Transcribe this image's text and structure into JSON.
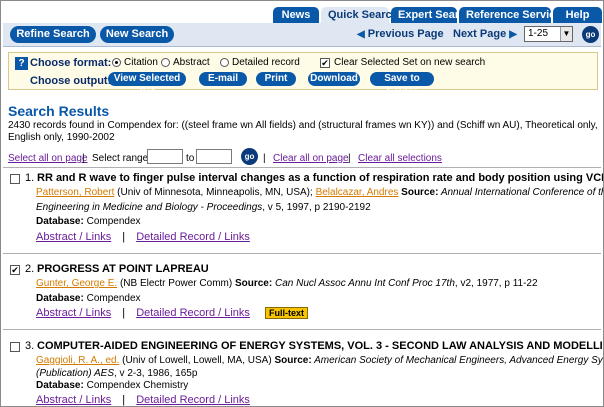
{
  "tabs": [
    "News",
    "Quick Search",
    "Expert Search",
    "Reference Services",
    "Help"
  ],
  "toolbar": {
    "refine_label": "Refine Search",
    "new_search_label": "New Search",
    "prev_label": "Previous Page",
    "next_label": "Next Page",
    "range_value": "1-25",
    "go_label": "go"
  },
  "options": {
    "format_label": "Choose format:",
    "output_label": "Choose output:",
    "formats": [
      "Citation",
      "Abstract",
      "Detailed record"
    ],
    "selected_format": "Citation",
    "clear_label": "Clear Selected Set on new search",
    "clear_checked": true,
    "buttons": [
      "View Selected Set",
      "E-mail",
      "Print",
      "Download",
      "Save to Folder"
    ]
  },
  "results": {
    "title": "Search Results",
    "summary": "2430 records found in Compendex for: ((steel frame wn All fields) and (structural frames wn KY)) and (Schiff wn AU), Theoretical only, English only, 1990-2002",
    "select_all": "Select all on page",
    "select_range": "Select range:",
    "to_label": "to",
    "clear_page": "Clear all on page",
    "clear_selections": "Clear all selections",
    "go_label": "go"
  },
  "records": [
    {
      "num": "1.",
      "checked": false,
      "title": "RR and R wave to finger pulse interval changes as a function of respiration rate and body position using VCRS",
      "authors": [
        "Patterson, Robert",
        "Belalcazar, Andres"
      ],
      "aff1": " (Univ of Minnesota, Minneapolis, MN, USA); ",
      "aff2": " ",
      "source_label": "Source:",
      "source1": " Annual International Conference of the IEEE",
      "source2": "Engineering in Medicine and Biology - Proceedings",
      "source3": ", v 5, 1997, p 2190-2192",
      "db_label": "Database:",
      "db": " Compendex",
      "abstract_link": "Abstract / Links",
      "detailed_link": "Detailed Record / Links"
    },
    {
      "num": "2.",
      "checked": true,
      "title": "PROGRESS AT POINT LAPREAU",
      "author": "Gunter, George E.",
      "aff": " (NB Electr Power Comm) ",
      "source_label": "Source:",
      "source1": " Can Nucl Assoc Annu Int Conf Proc 17th",
      "source2": ", v2, 1977, p 11-22",
      "db_label": "Database:",
      "db": " Compendex",
      "abstract_link": "Abstract / Links",
      "detailed_link": "Detailed Record / Links",
      "fulltext": "Full-text"
    },
    {
      "num": "3.",
      "checked": false,
      "title": "COMPUTER-AIDED ENGINEERING OF ENERGY SYSTEMS, VOL. 3 - SECOND LAW ANALYSIS AND MODELLING",
      "author": "Gaggioli, R. A., ed.",
      "aff": " (Univ of Lowell, Lowell, MA, USA) ",
      "source_label": "Source:",
      "source1": " American Society of Mechanical Engineers, Advanced Energy Systems Division",
      "source2": "(Publication) AES",
      "source3": ", v 2-3, 1986, 165p",
      "db_label": "Database:",
      "db": " Compendex Chemistry",
      "abstract_link": "Abstract / Links",
      "detailed_link": "Detailed Record / Links"
    }
  ]
}
